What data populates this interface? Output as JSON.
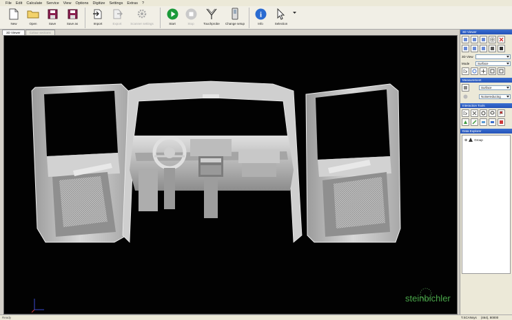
{
  "menu": [
    "File",
    "Edit",
    "Calculate",
    "Service",
    "View",
    "Options",
    "Digitize",
    "Settings",
    "Extras",
    "?"
  ],
  "toolbar": {
    "buttons": [
      {
        "label": "New",
        "icon": "new-file-icon"
      },
      {
        "label": "Open",
        "icon": "open-folder-icon"
      },
      {
        "label": "Save",
        "icon": "save-icon"
      },
      {
        "label": "Save as",
        "icon": "save-as-icon"
      },
      {
        "label": "Import",
        "icon": "import-icon"
      },
      {
        "label": "Export",
        "icon": "export-icon"
      },
      {
        "label": "Scanner settings",
        "icon": "scanner-settings-icon"
      },
      {
        "label": "Start",
        "icon": "start-icon"
      },
      {
        "label": "Stop",
        "icon": "stop-icon"
      },
      {
        "label": "Touchprobe",
        "icon": "touchprobe-icon"
      },
      {
        "label": "Change setup",
        "icon": "change-setup-icon"
      },
      {
        "label": "Info",
        "icon": "info-icon"
      },
      {
        "label": "Selection",
        "icon": "selection-cursor-icon"
      }
    ]
  },
  "tabs": [
    {
      "label": "3D Viewer"
    },
    {
      "label": "Colour sections"
    }
  ],
  "right_panel": {
    "viewer": {
      "title": "3D Viewer",
      "view_label": "3D View",
      "mode_label": "Mode",
      "mode_value": "Surface"
    },
    "measurement": {
      "title": "Measurement",
      "opt1": "Surface",
      "opt2": "Noisereducing"
    },
    "interaction": {
      "title": "Interaction Tools"
    },
    "explorer": {
      "title": "Data Explorer",
      "item": "Group"
    }
  },
  "status": {
    "left": "Ready",
    "file": "T.SCANsys",
    "coords": "(464), 80000"
  },
  "watermark": "steinbichler",
  "colors": {
    "accent": "#2452b8",
    "viewport": "#020202",
    "model": "#cfcfcf"
  }
}
